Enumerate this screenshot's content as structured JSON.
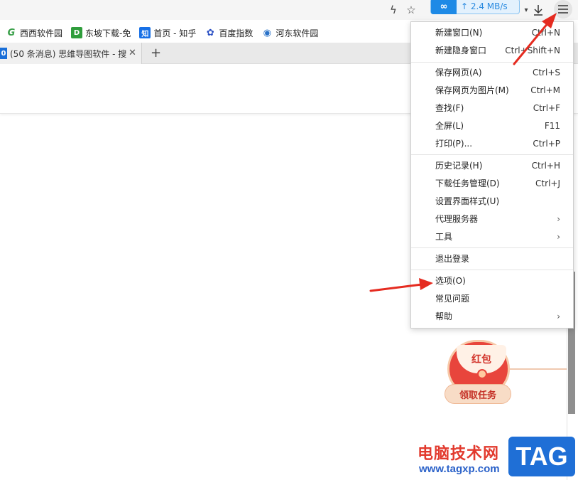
{
  "toolbar": {
    "speed_logo": "∞",
    "speed_text": "↑ 2.4 MB/s"
  },
  "bookmarks": [
    {
      "label": "西西软件园",
      "icon": "cc-leaf-icon",
      "icon_text": "G",
      "color": "#3aa04a"
    },
    {
      "label": "东坡下载-免",
      "icon": "dongpo-icon",
      "icon_text": "D",
      "color": "#2f9d3c"
    },
    {
      "label": "首页 - 知乎",
      "icon": "zhihu-icon",
      "icon_text": "知",
      "color": "#1770e6"
    },
    {
      "label": "百度指数",
      "icon": "baidu-paw-icon",
      "icon_text": "✿",
      "color": "#2a4fc4"
    },
    {
      "label": "河东软件园",
      "icon": "hedong-icon",
      "icon_text": "◉",
      "color": "#2a72c8"
    }
  ],
  "tabs": [
    {
      "title": "(50 条消息) 思维导图软件 - 搜",
      "favicon_text": "0"
    }
  ],
  "red_packet": {
    "title": "红包",
    "banner": "领取任务"
  },
  "watermark": {
    "title": "电脑技术网",
    "url": "www.tagxp.com",
    "badge": "TAG"
  },
  "menu": {
    "items": [
      {
        "label": "新建窗口(N)",
        "shortcut": "Ctrl+N"
      },
      {
        "label": "新建隐身窗口",
        "shortcut": "Ctrl+Shift+N"
      },
      {
        "label": "保存网页(A)",
        "shortcut": "Ctrl+S"
      },
      {
        "label": "保存网页为图片(M)",
        "shortcut": "Ctrl+M"
      },
      {
        "label": "查找(F)",
        "shortcut": "Ctrl+F"
      },
      {
        "label": "全屏(L)",
        "shortcut": "F11"
      },
      {
        "label": "打印(P)...",
        "shortcut": "Ctrl+P"
      },
      {
        "label": "历史记录(H)",
        "shortcut": "Ctrl+H"
      },
      {
        "label": "下载任务管理(D)",
        "shortcut": "Ctrl+J"
      },
      {
        "label": "设置界面样式(U)",
        "shortcut": ""
      },
      {
        "label": "代理服务器",
        "shortcut": "",
        "submenu": "›"
      },
      {
        "label": "工具",
        "shortcut": "",
        "submenu": "›"
      },
      {
        "label": "退出登录",
        "shortcut": ""
      },
      {
        "label": "选项(O)",
        "shortcut": ""
      },
      {
        "label": "常见问题",
        "shortcut": ""
      },
      {
        "label": "帮助",
        "shortcut": "",
        "submenu": "›"
      }
    ]
  }
}
